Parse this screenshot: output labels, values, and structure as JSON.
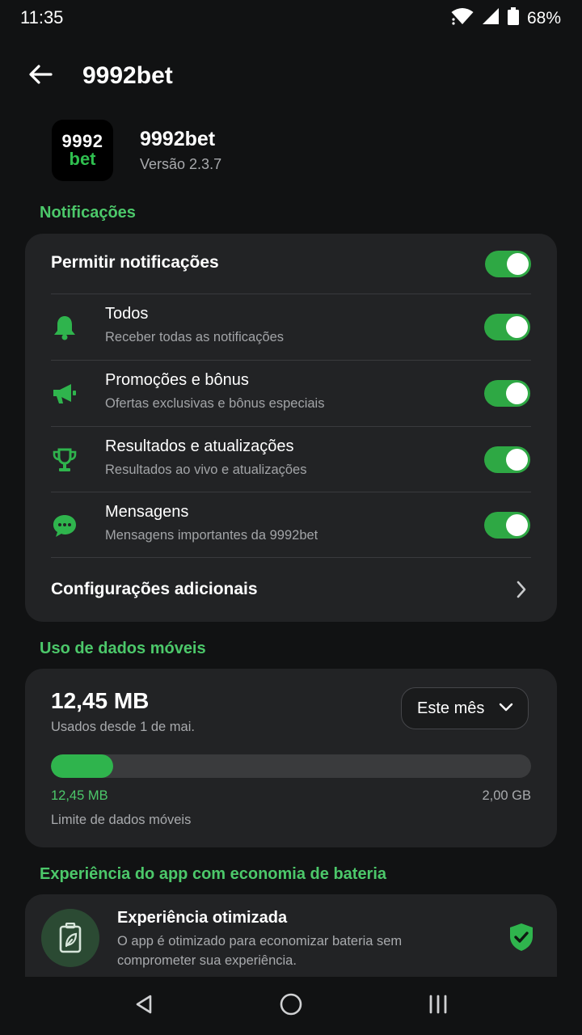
{
  "status_bar": {
    "time": "11:35",
    "battery_percent": "68%",
    "icons": [
      "wifi-icon",
      "signal-icon",
      "battery-icon"
    ]
  },
  "app_bar": {
    "back_icon": "arrow-left-icon",
    "title": "9992bet"
  },
  "app_info": {
    "logo_line1": "9992",
    "logo_line2": "bet",
    "name": "9992bet",
    "version": "Versão 2.3.7"
  },
  "notifications": {
    "section_label": "Notificações",
    "master_label": "Permitir notificações",
    "master_enabled": true,
    "items": [
      {
        "icon": "bell-icon",
        "title": "Todos",
        "subtitle": "Receber todas as notificações",
        "enabled": true
      },
      {
        "icon": "megaphone-icon",
        "title": "Promoções e bônus",
        "subtitle": "Ofertas exclusivas e bônus especiais",
        "enabled": true
      },
      {
        "icon": "trophy-icon",
        "title": "Resultados e atualizações",
        "subtitle": "Resultados ao vivo e atualizações",
        "enabled": true
      },
      {
        "icon": "chat-bubble-icon",
        "title": "Mensagens",
        "subtitle": "Mensagens importantes da 9992bet",
        "enabled": true
      }
    ],
    "extra_label": "Configurações adicionais"
  },
  "data_usage": {
    "section_label": "Uso de dados móveis",
    "amount": "12,45 MB",
    "since": "Usados desde 1 de mai.",
    "period": "Este mês",
    "used_label": "12,45 MB",
    "limit_value": "2,00 GB",
    "limit_label": "Limite de dados móveis",
    "usage_fraction": 0.13,
    "accent_color": "#2fb44d"
  },
  "battery": {
    "section_label": "Experiência do app com economia de bateria",
    "title": "Experiência otimizada",
    "description": "O app é otimizado para economizar bateria sem comprometer sua experiência.",
    "icon": "battery-leaf-icon",
    "status_icon": "shield-check-icon"
  },
  "nav_bar": {
    "buttons": [
      "back-triangle-icon",
      "home-circle-icon",
      "recents-icon"
    ]
  }
}
